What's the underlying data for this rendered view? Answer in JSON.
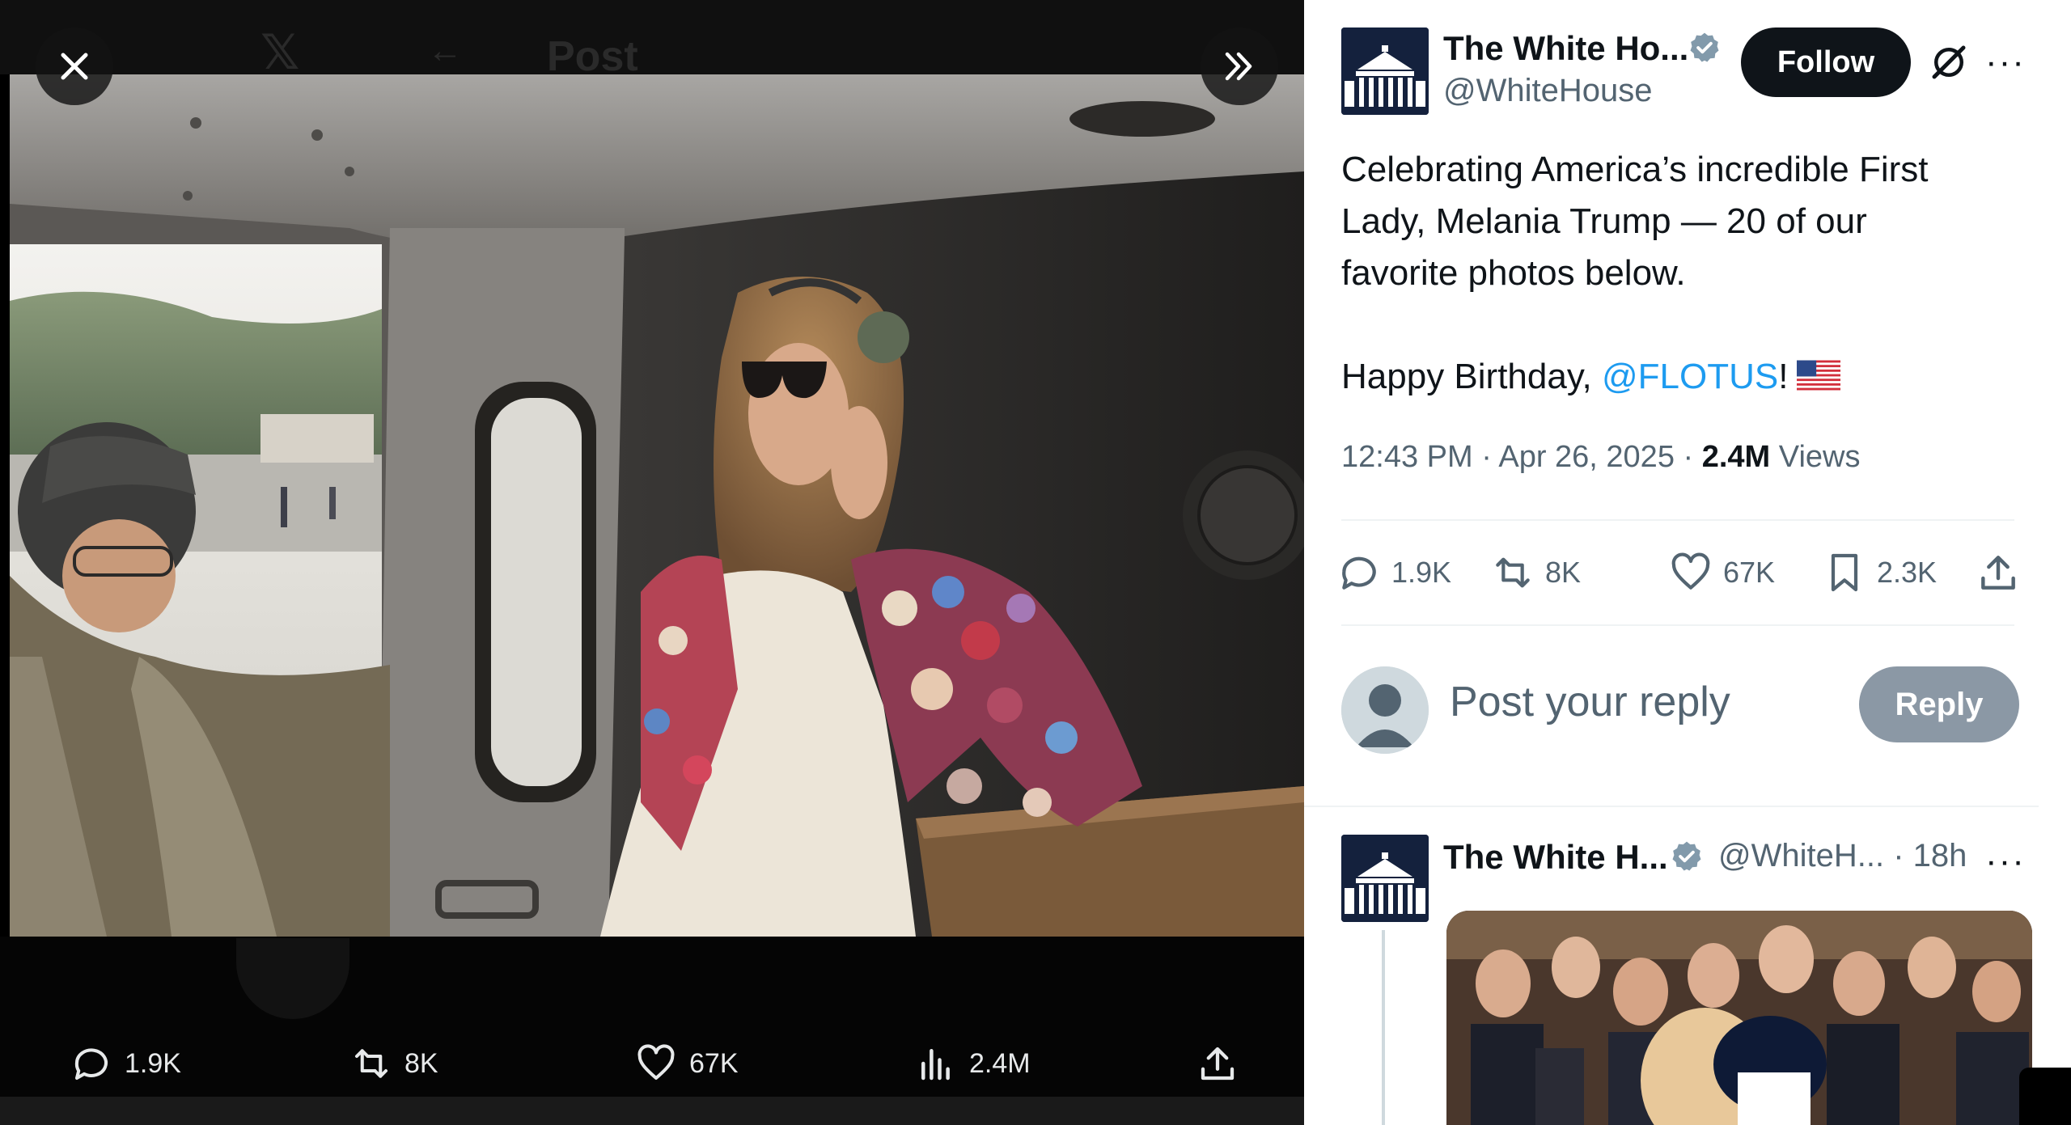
{
  "media_view": {
    "header_title": "Post",
    "close_label": "Close",
    "expand_label": "Expand",
    "stats": {
      "replies": "1.9K",
      "reposts": "8K",
      "likes": "67K",
      "views": "2.4M"
    }
  },
  "post": {
    "author_name": "The White Ho...",
    "handle": "@WhiteHouse",
    "follow_label": "Follow",
    "text_lines": [
      "Celebrating America’s incredible First",
      "Lady, Melania Trump — 20 of our",
      "favorite photos below."
    ],
    "birthday_prefix": "Happy Birthday, ",
    "mention": "@FLOTUS",
    "birthday_suffix": "!",
    "time": "12:43 PM",
    "date": "Apr 26, 2025",
    "views_count": "2.4M",
    "views_label": "Views",
    "actions": {
      "replies": "1.9K",
      "reposts": "8K",
      "likes": "67K",
      "bookmarks": "2.3K"
    }
  },
  "reply_box": {
    "placeholder": "Post your reply",
    "button_label": "Reply"
  },
  "next_post": {
    "author_name": "The White H...",
    "handle": "@WhiteH...",
    "time": "18h"
  },
  "colors": {
    "accent": "#1d9bf0",
    "text_primary": "#0f1419",
    "text_secondary": "#536471",
    "follow_bg": "#0f1419",
    "reply_btn_bg": "#8b98a5",
    "verified": "#829aab"
  },
  "icons": {
    "close": "close-icon",
    "expand": "double-chevron-right-icon",
    "reply": "speech-bubble-icon",
    "repost": "repost-arrows-icon",
    "like": "heart-icon",
    "views": "bar-chart-icon",
    "share": "share-upload-icon",
    "bookmark": "bookmark-icon",
    "grok": "grok-icon",
    "more": "more-dots-icon",
    "verified": "verified-badge-icon",
    "flag": "us-flag-emoji"
  }
}
